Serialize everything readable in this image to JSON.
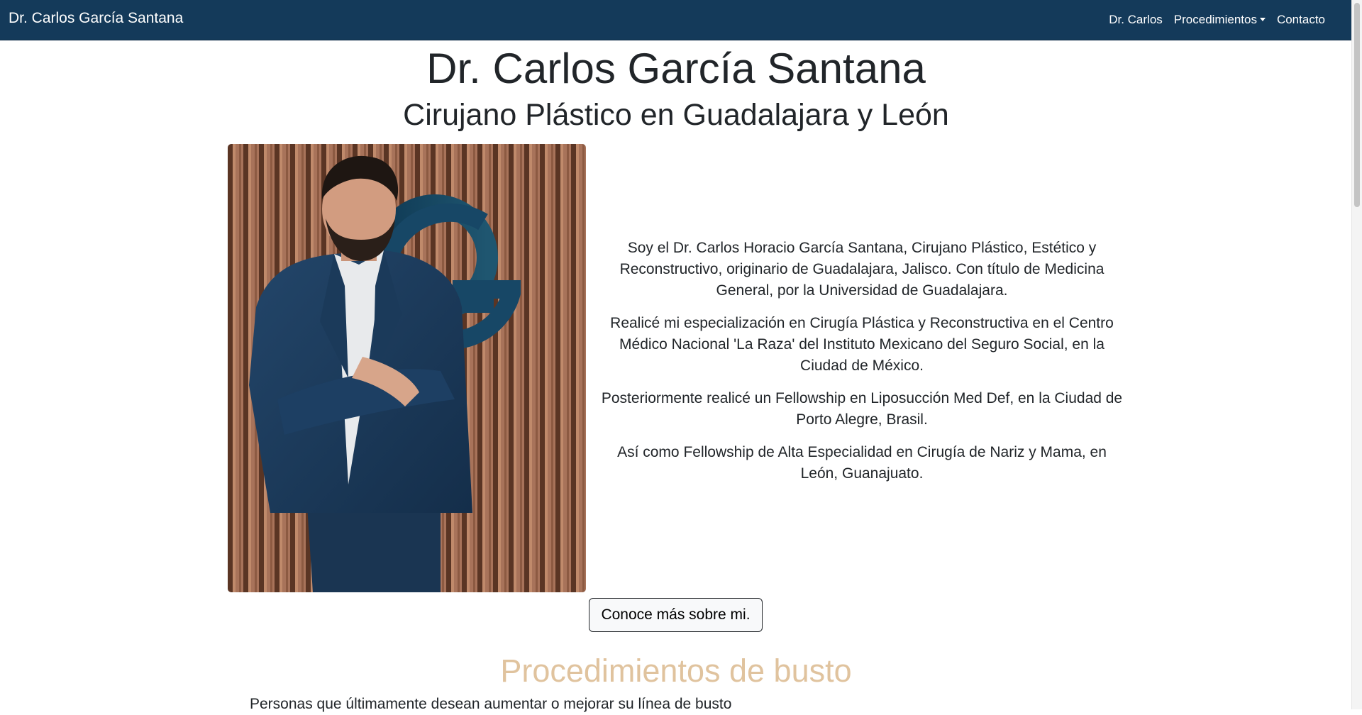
{
  "navbar": {
    "brand": "Dr. Carlos García Santana",
    "links": [
      {
        "label": "Dr. Carlos"
      },
      {
        "label": "Procedimientos"
      },
      {
        "label": "Contacto"
      }
    ]
  },
  "hero": {
    "title": "Dr. Carlos García Santana",
    "subtitle": "Cirujano Plástico en Guadalajara y León"
  },
  "about": {
    "image_alt": "portrait-photo",
    "paragraphs": [
      "Soy el Dr. Carlos Horacio García Santana, Cirujano Plástico, Estético y Reconstructivo, originario de Guadalajara, Jalisco. Con título de Medicina General, por la Universidad de Guadalajara.",
      "Realicé mi especialización en Cirugía Plástica y Reconstructiva en el Centro Médico Nacional 'La Raza' del Instituto Mexicano del Seguro Social, en la Ciudad de México.",
      "Posteriormente realicé un Fellowship en Liposucción Med Def, en la Ciudad de Porto Alegre, Brasil.",
      "Así como Fellowship de Alta Especialidad en Cirugía de Nariz y Mama, en León, Guanajuato."
    ],
    "button_label": "Conoce más sobre mi."
  },
  "procedures": {
    "title": "Procedimientos de busto",
    "intro": "Personas que últimamente desean aumentar o mejorar su línea de busto"
  },
  "colors": {
    "navbar": "#143a5a",
    "section_title": "#e0c39e",
    "text": "#212529"
  }
}
